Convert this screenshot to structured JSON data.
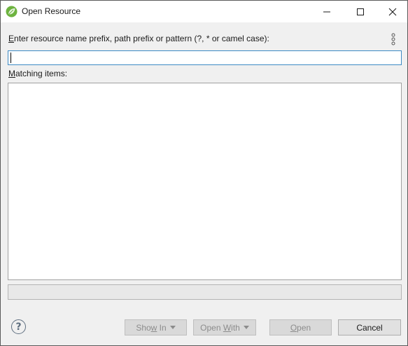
{
  "window": {
    "title": "Open Resource",
    "icon": "spring-leaf-icon",
    "controls": {
      "minimize": "minimize-icon",
      "maximize": "maximize-icon",
      "close": "close-icon"
    }
  },
  "search": {
    "label_mnemonic": "E",
    "label_rest": "nter resource name prefix, path prefix or pattern (?, * or camel case):",
    "value": "",
    "menu_icon": "view-menu-icon"
  },
  "results": {
    "label_mnemonic": "M",
    "label_rest": "atching items:",
    "items": []
  },
  "status": {
    "text": ""
  },
  "buttons": {
    "help_icon": "help-icon",
    "show_in_pre": "Sho",
    "show_in_mnemonic": "w",
    "show_in_post": " In",
    "open_with_pre": "Open ",
    "open_with_mnemonic": "W",
    "open_with_post": "ith",
    "open_mnemonic": "O",
    "open_post": "pen",
    "cancel": "Cancel"
  },
  "colors": {
    "accent_border": "#3c8ac4",
    "spring_green": "#6db33f"
  }
}
